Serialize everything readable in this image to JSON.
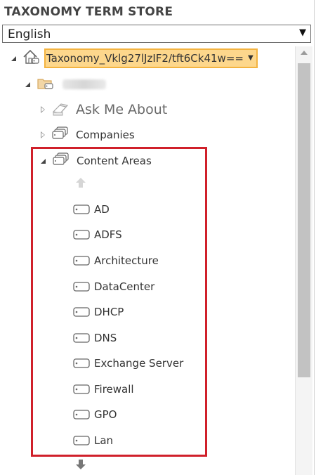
{
  "header": {
    "title": "TAXONOMY TERM STORE"
  },
  "language_select": {
    "value": "English"
  },
  "tree": {
    "root": {
      "label": "Taxonomy_Vklg27lJzIF2/tft6Ck41w==",
      "icon": "home-icon"
    },
    "group": {
      "label": "",
      "icon": "folder-icon"
    },
    "term_sets": [
      {
        "label": "Ask Me About",
        "icon": "termset-disabled-icon",
        "expanded": false
      },
      {
        "label": "Companies",
        "icon": "termset-icon",
        "expanded": false
      },
      {
        "label": "Content Areas",
        "icon": "termset-icon",
        "expanded": true
      }
    ],
    "terms": [
      {
        "label": "AD"
      },
      {
        "label": "ADFS"
      },
      {
        "label": "Architecture"
      },
      {
        "label": "DataCenter"
      },
      {
        "label": "DHCP"
      },
      {
        "label": "DNS"
      },
      {
        "label": "Exchange Server"
      },
      {
        "label": "Firewall"
      },
      {
        "label": "GPO"
      },
      {
        "label": "Lan"
      }
    ]
  },
  "colors": {
    "highlight": "#d0202a",
    "selected_bg": "#fdd78c",
    "selected_border": "#f3b340"
  }
}
